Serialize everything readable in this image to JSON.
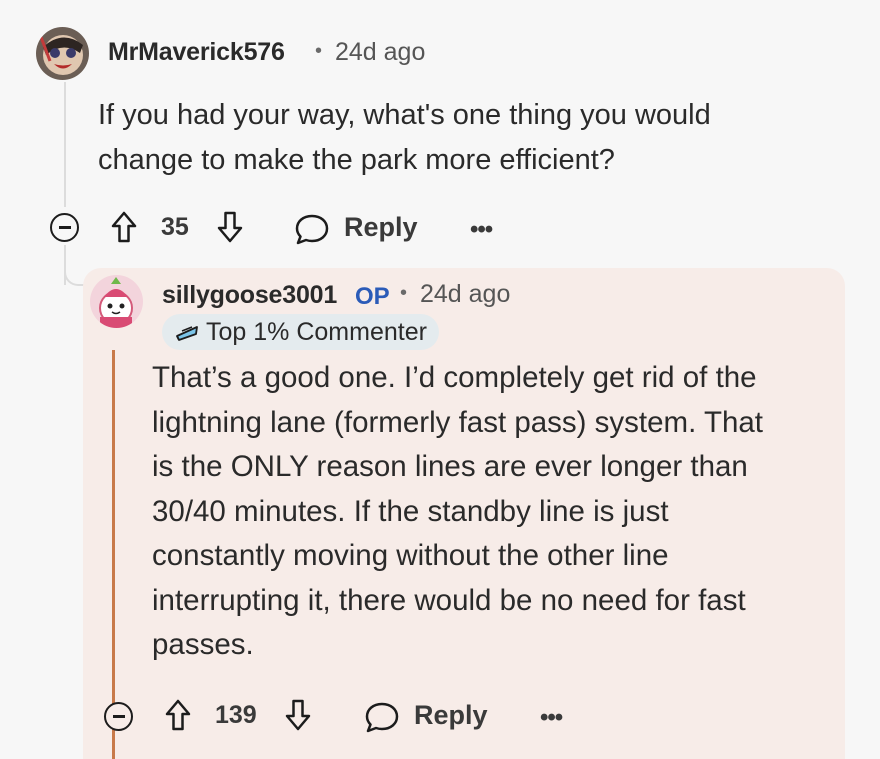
{
  "parent_comment": {
    "username": "MrMaverick576",
    "separator": "•",
    "time": "24d ago",
    "body_lines": [
      "If you had your way, what's one thing you would",
      "change to make the park more efficient?"
    ],
    "upvotes": "35",
    "reply_label": "Reply",
    "more_label": "•••"
  },
  "reply_comment": {
    "username": "sillygoose3001",
    "op_label": "OP",
    "separator": "•",
    "time": "24d ago",
    "badge_label": "Top 1% Commenter",
    "body_lines": [
      "That’s a good one. I’d completely get rid of the",
      "lightning lane (formerly fast pass) system. That",
      "is the ONLY reason lines are ever longer than",
      "30/40 minutes. If the standby line is just",
      "constantly moving without the other line",
      "interrupting it, there would be no need for fast",
      "passes."
    ],
    "upvotes": "139",
    "reply_label": "Reply",
    "more_label": "•••"
  },
  "colors": {
    "op": "#2b5bb8",
    "reply_card_bg": "#f7ece8",
    "thread_line": "#dcdcdc",
    "reply_bar": "#c87a4a",
    "badge_bg": "#e4ebee"
  }
}
